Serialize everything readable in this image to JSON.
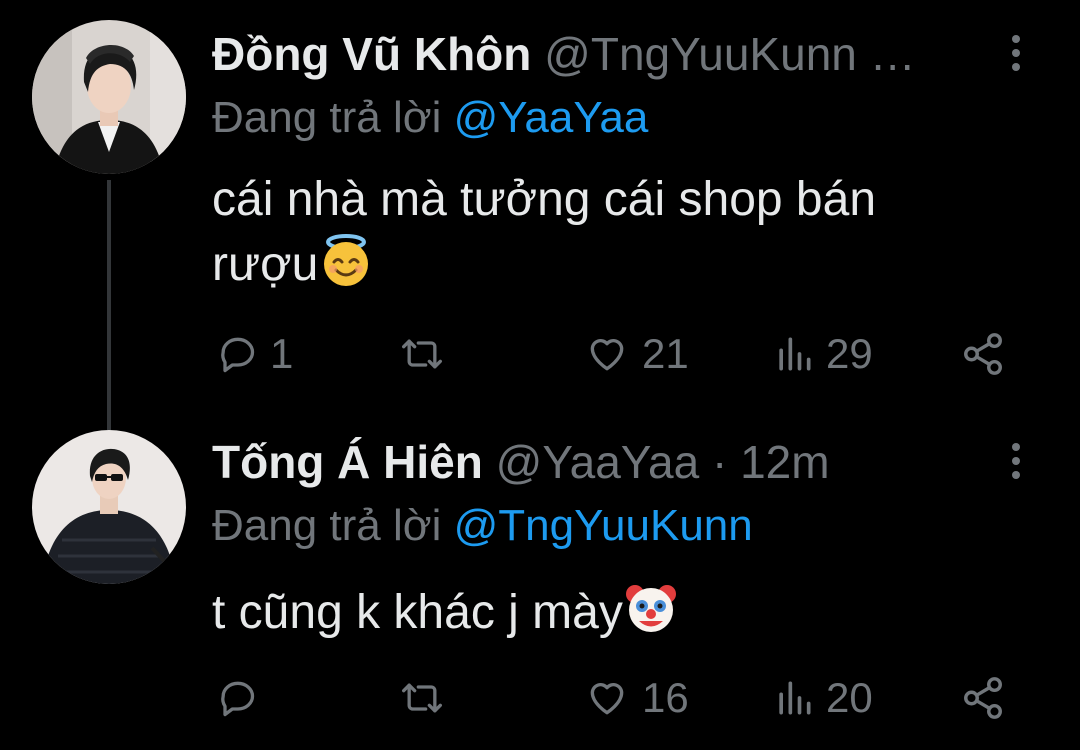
{
  "tweets": [
    {
      "display_name": "Đồng Vũ Khôn",
      "handle": "@TngYuuKunn …",
      "replying_prefix": "Đang trả lời",
      "replying_to": "@YaaYaa",
      "text_line1": "cái nhà mà tưởng cái shop bán",
      "text_line2": "rượu",
      "emoji": "halo-smile-emoji",
      "reply_count": "1",
      "retweet_count": "",
      "like_count": "21",
      "view_count": "29"
    },
    {
      "display_name": "Tống Á Hiên",
      "handle": "@YaaYaa · 12m",
      "replying_prefix": "Đang trả lời",
      "replying_to": "@TngYuuKunn",
      "text_line1": "t cũng k khác j mày",
      "emoji": "clown-face-emoji",
      "reply_count": "",
      "retweet_count": "",
      "like_count": "16",
      "view_count": "20"
    }
  ],
  "icons": {
    "reply": "reply-icon",
    "retweet": "retweet-icon",
    "like": "heart-icon",
    "views": "views-icon",
    "share": "share-icon",
    "more": "more-vertical-icon"
  },
  "colors": {
    "background": "#000000",
    "primary_text": "#e7e9ea",
    "secondary_text": "#71767b",
    "accent": "#1d9bf0",
    "thread_line": "#333639"
  }
}
